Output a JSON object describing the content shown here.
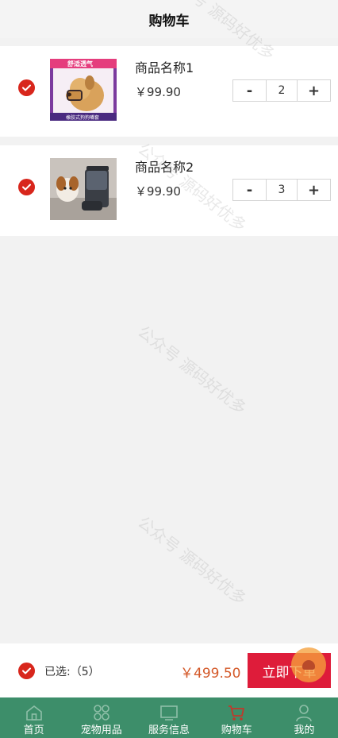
{
  "header": {
    "title": "购物车"
  },
  "items": [
    {
      "name": "商品名称1",
      "price": "￥99.90",
      "quantity": "2",
      "minus_label": "-",
      "plus_label": "+",
      "image_caption_top": "舒适透气",
      "image_caption_bottom": "橡胶式狗狗嘴套"
    },
    {
      "name": "商品名称2",
      "price": "￥99.90",
      "quantity": "3",
      "minus_label": "-",
      "plus_label": "+"
    }
  ],
  "footer": {
    "selected_label": "已选:（5）",
    "total": "￥499.50",
    "order_button": "立即下单"
  },
  "tabbar": {
    "tabs": [
      {
        "label": "首页",
        "icon": "home-icon"
      },
      {
        "label": "宠物用品",
        "icon": "grid-icon"
      },
      {
        "label": "服务信息",
        "icon": "monitor-icon"
      },
      {
        "label": "购物车",
        "icon": "cart-icon",
        "active": true
      },
      {
        "label": "我的",
        "icon": "user-icon"
      }
    ]
  },
  "watermark": "公众号 源码好优多",
  "colors": {
    "accent_red": "#d8261c",
    "order_button": "#de1c3a",
    "price_total": "#d45a2a",
    "tabbar_bg": "#3d8e6a",
    "tab_active_icon": "#c0392b"
  }
}
